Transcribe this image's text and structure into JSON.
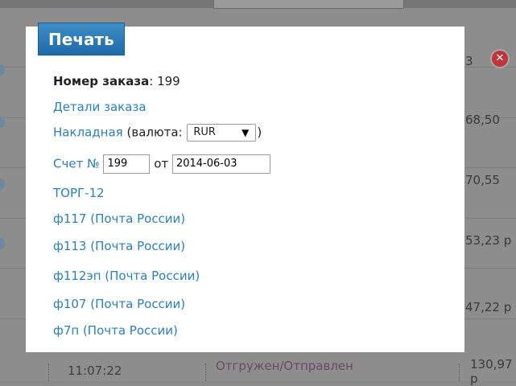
{
  "modal": {
    "title": "Печать",
    "order_label": "Номер заказа",
    "order_colon": ":",
    "order_number": "199",
    "details_link": "Детали заказа",
    "invoice_link": "Накладная",
    "currency_prefix": "(валюта:",
    "currency_value": "RUR",
    "currency_suffix": ")",
    "bill_link": "Счет №",
    "bill_number": "199",
    "bill_from": "от",
    "bill_date": "2014-06-03",
    "links": [
      "ТОРГ-12",
      "ф117 (Почта России)",
      "ф113 (Почта России)",
      "ф112эп (Почта России)",
      "ф107 (Почта России)",
      "ф7п (Почта России)"
    ]
  },
  "background": {
    "amounts": [
      "3",
      "68,50",
      "70,55",
      "53,23 р",
      "47,22 р",
      "130,97 р"
    ],
    "bottom_time": "11:07:22",
    "bottom_status": "Отгружен/Отправлен"
  },
  "colors": {
    "accent": "#2c7fb8",
    "title_bg": "#2a7bbb",
    "close": "#c2343b"
  },
  "icons": {
    "close": "close-icon",
    "dropdown": "chevron-down-icon"
  }
}
